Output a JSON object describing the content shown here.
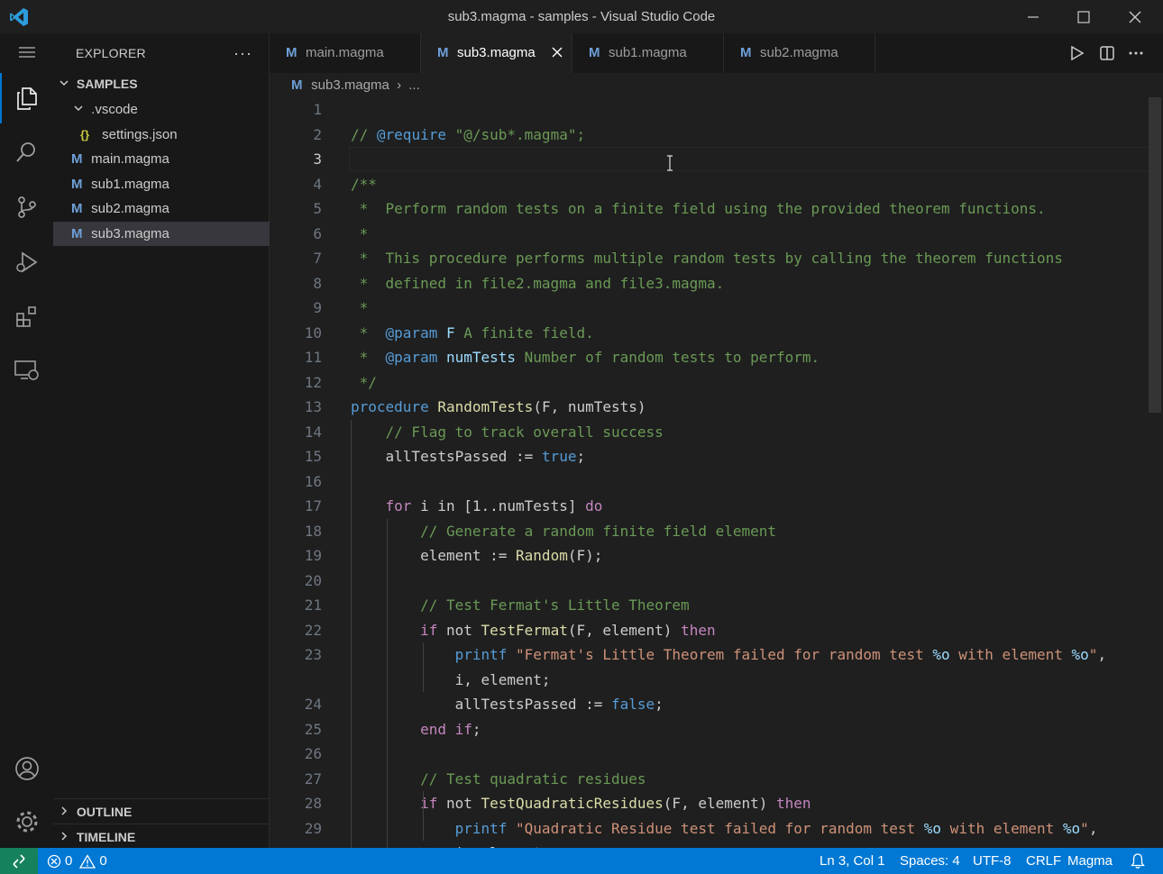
{
  "window": {
    "title": "sub3.magma - samples - Visual Studio Code"
  },
  "sidebar": {
    "header": "EXPLORER",
    "more": "···",
    "root": "SAMPLES",
    "tree": [
      {
        "kind": "folder",
        "label": ".vscode"
      },
      {
        "kind": "json",
        "label": "settings.json",
        "icon_text": "{}"
      },
      {
        "kind": "magma",
        "label": "main.magma",
        "icon_text": "M"
      },
      {
        "kind": "magma",
        "label": "sub1.magma",
        "icon_text": "M"
      },
      {
        "kind": "magma",
        "label": "sub2.magma",
        "icon_text": "M"
      },
      {
        "kind": "magma",
        "label": "sub3.magma",
        "icon_text": "M",
        "selected": true
      }
    ],
    "panels": [
      "OUTLINE",
      "TIMELINE"
    ]
  },
  "tabs": [
    {
      "label": "main.magma",
      "icon_text": "M",
      "active": false
    },
    {
      "label": "sub3.magma",
      "icon_text": "M",
      "active": true
    },
    {
      "label": "sub1.magma",
      "icon_text": "M",
      "active": false
    },
    {
      "label": "sub2.magma",
      "icon_text": "M",
      "active": false
    }
  ],
  "breadcrumb": {
    "icon_text": "M",
    "file": "sub3.magma",
    "sep": "›",
    "rest": "..."
  },
  "editor": {
    "current_line": 3,
    "lines": [
      {
        "n": "1",
        "html": ""
      },
      {
        "n": "2",
        "html": "<span class='c-com'>//·<span class='c-tag'>@require</span>·\"@/sub*.magma\";</span>"
      },
      {
        "n": "3",
        "html": ""
      },
      {
        "n": "4",
        "html": "<span class='c-com'>/**</span>"
      },
      {
        "n": "5",
        "html": "<span class='c-com'>·*··Perform·random·tests·on·a·finite·field·using·the·provided·theorem·functions.</span>"
      },
      {
        "n": "6",
        "html": "<span class='c-com'>·*</span>"
      },
      {
        "n": "7",
        "html": "<span class='c-com'>·*··This·procedure·performs·multiple·random·tests·by·calling·the·theorem·functions</span>"
      },
      {
        "n": "8",
        "html": "<span class='c-com'>·*··defined·in·file2.magma·and·file3.magma.</span>"
      },
      {
        "n": "9",
        "html": "<span class='c-com'>·*</span>"
      },
      {
        "n": "10",
        "html": "<span class='c-com'>·*··<span class='c-tag'>@param</span>·<span class='c-var'>F</span>·A·finite·field.</span>"
      },
      {
        "n": "11",
        "html": "<span class='c-com'>·*··<span class='c-tag'>@param</span>·<span class='c-var'>numTests</span>·Number·of·random·tests·to·perform.</span>"
      },
      {
        "n": "12",
        "html": "<span class='c-com'>·*/</span>"
      },
      {
        "n": "13",
        "html": "<span class='c-blue'>procedure</span> <span class='c-fn'>RandomTests</span>(F,·numTests)"
      },
      {
        "n": "14",
        "html": "<span class='ws'>····</span><span class='c-com'>//·Flag·to·track·overall·success</span>"
      },
      {
        "n": "15",
        "html": "<span class='ws'>····</span>allTestsPassed·:=·<span class='c-blue'>true</span>;"
      },
      {
        "n": "16",
        "html": ""
      },
      {
        "n": "17",
        "html": "<span class='ws'>····</span><span class='c-kw'>for</span>·i·in·[1..numTests]·<span class='c-kw'>do</span>"
      },
      {
        "n": "18",
        "html": "<span class='ws'>········</span><span class='c-com'>//·Generate·a·random·finite·field·element</span>"
      },
      {
        "n": "19",
        "html": "<span class='ws'>········</span>element·:=·<span class='c-fn'>Random</span>(F);"
      },
      {
        "n": "20",
        "html": "<span class='ws'>········</span>"
      },
      {
        "n": "21",
        "html": "<span class='ws'>········</span><span class='c-com'>//·Test·Fermat's·Little·Theorem</span>"
      },
      {
        "n": "22",
        "html": "<span class='ws'>········</span><span class='c-kw'>if</span>·not·<span class='c-fn'>TestFermat</span>(F,·element)·<span class='c-kw'>then</span>"
      },
      {
        "n": "23",
        "html": "<span class='ws'>············</span><span class='c-blue'>printf</span>·<span class='c-str'>\"Fermat's·Little·Theorem·failed·for·random·test·<span class='c-var'>%o</span>·with·element·<span class='c-var'>%o</span>\"</span>,"
      },
      {
        "n": "",
        "html": "<span class='ws'>············</span>i,·element;"
      },
      {
        "n": "24",
        "html": "<span class='ws'>············</span>allTestsPassed·:=·<span class='c-blue'>false</span>;"
      },
      {
        "n": "25",
        "html": "<span class='ws'>········</span><span class='c-kw'>end</span>·<span class='c-kw'>if</span>;"
      },
      {
        "n": "26",
        "html": "<span class='ws'>········</span>"
      },
      {
        "n": "27",
        "html": "<span class='ws'>········</span><span class='c-com'>//·Test·quadratic·residues</span>"
      },
      {
        "n": "28",
        "html": "<span class='ws'>········</span><span class='c-kw'>if</span>·not·<span class='c-fn'>TestQuadraticResidues</span>(F,·element)·<span class='c-kw'>then</span>"
      },
      {
        "n": "29",
        "html": "<span class='ws'>············</span><span class='c-blue'>printf</span>·<span class='c-str'>\"Quadratic·Residue·test·failed·for·random·test·<span class='c-var'>%o</span>·with·element·<span class='c-var'>%o</span>\"</span>,"
      },
      {
        "n": "",
        "html": "<span class='ws'>············</span>i,·element;"
      }
    ]
  },
  "statusbar": {
    "errors": "0",
    "warnings": "0",
    "position": "Ln 3, Col 1",
    "spaces": "Spaces: 4",
    "encoding": "UTF-8",
    "eol": "CRLF",
    "language": "Magma"
  },
  "colors": {
    "accent": "#0078d4",
    "remote": "#16825d"
  }
}
